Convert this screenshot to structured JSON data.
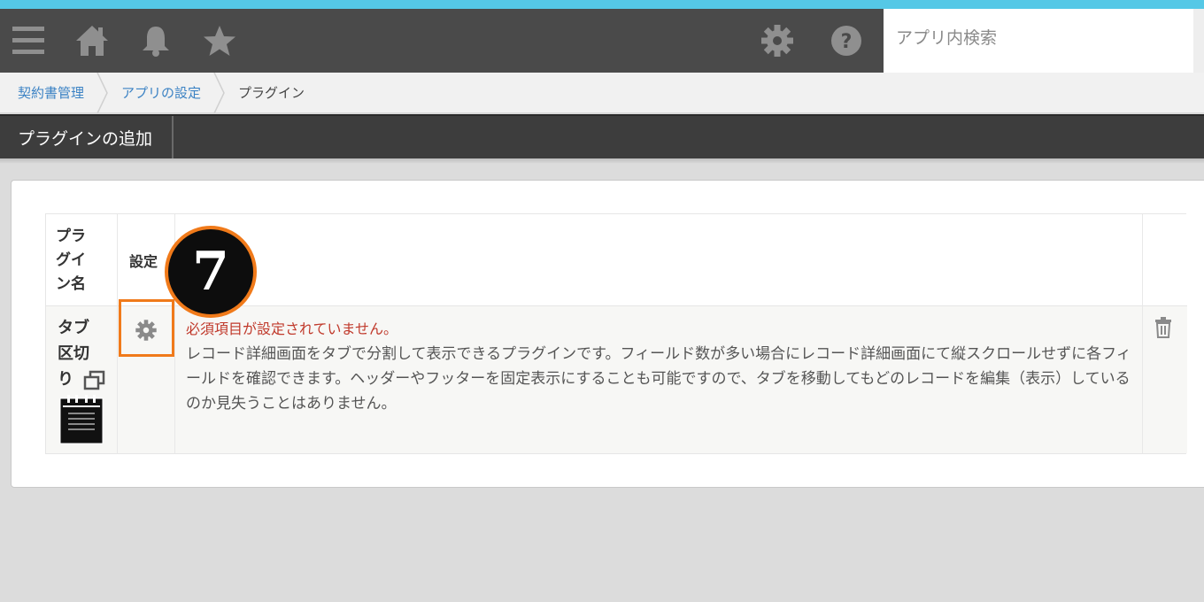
{
  "header": {
    "search_placeholder": "アプリ内検索",
    "icons": [
      "menu-icon",
      "home-icon",
      "bell-icon",
      "star-icon",
      "gear-icon",
      "help-icon"
    ]
  },
  "breadcrumb": {
    "items": [
      {
        "label": "契約書管理"
      },
      {
        "label": "アプリの設定"
      },
      {
        "label": "プラグイン"
      }
    ]
  },
  "toolbar": {
    "add_plugin_label": "プラグインの追加"
  },
  "table": {
    "headers": {
      "plugin_name": "プラグイン名",
      "settings": "設定"
    },
    "rows": [
      {
        "name": "タブ区切り",
        "warning": "必須項目が設定されていません。",
        "description": "レコード詳細画面をタブで分割して表示できるプラグインです。フィールド数が多い場合にレコード詳細画面にて縦スクロールせずに各フィールドを確認できます。ヘッダーやフッターを固定表示にすることも可能ですので、タブを移動してもどのレコードを編集（表示）しているのか見失うことはありません。"
      }
    ]
  },
  "annotation": {
    "step_number": "7",
    "accent_color": "#f07a1a"
  },
  "colors": {
    "header_bg": "#4a4a4a",
    "accent_stripe": "#55c8e6",
    "link": "#3b82c4",
    "warning": "#c0392b"
  }
}
